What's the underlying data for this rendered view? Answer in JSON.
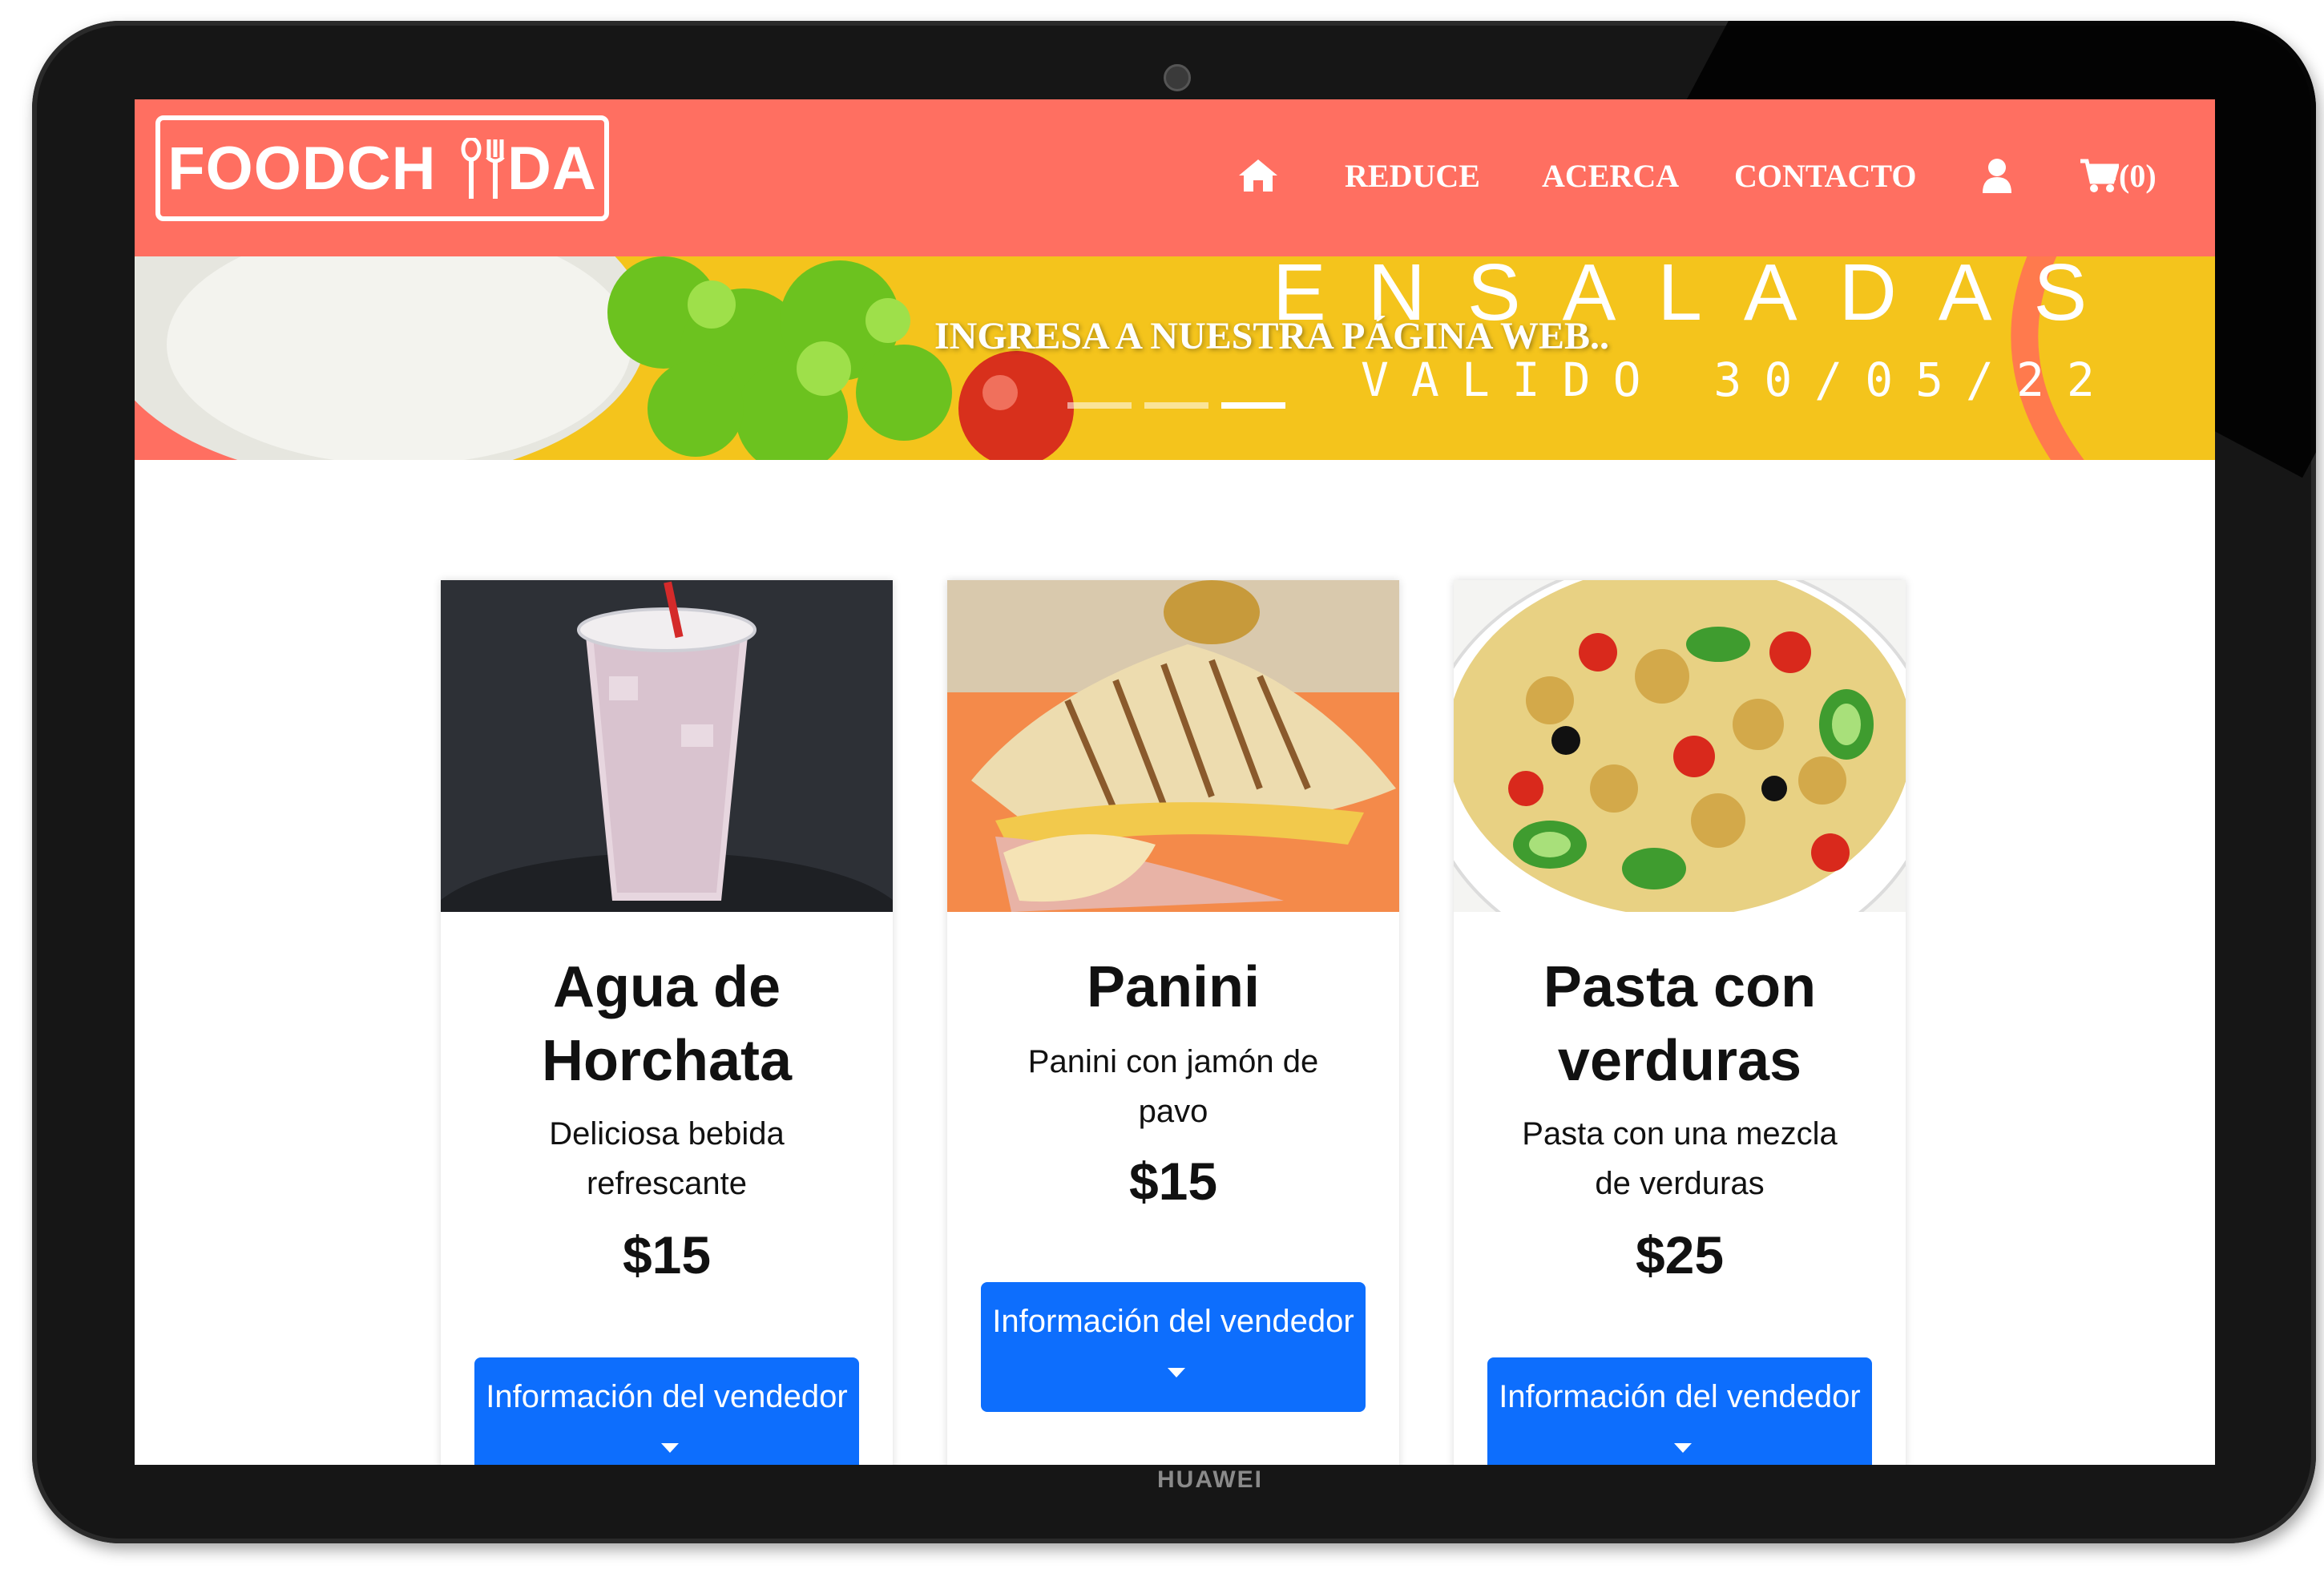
{
  "device": {
    "brand": "HUAWEI"
  },
  "navbar": {
    "logo_text": "FOODCH    DA",
    "items": [
      {
        "icon": "home-icon"
      },
      {
        "label": "REDUCE"
      },
      {
        "label": "ACERCA"
      },
      {
        "label": "CONTACTO"
      },
      {
        "icon": "user-icon"
      },
      {
        "icon": "cart-icon",
        "label": "(0)"
      }
    ]
  },
  "hero": {
    "title": "ENSALADAS",
    "subtitle": "VALIDO 30/05/22",
    "caption": "INGRESA A NUESTRA PÁGINA WEB..",
    "slides": 3,
    "active_slide": 3
  },
  "products": [
    {
      "title": "Agua de Horchata",
      "description": "Deliciosa bebida refrescante",
      "price": "$15",
      "button": "Información del vendedor"
    },
    {
      "title": "Panini",
      "description": "Panini con jamón de pavo",
      "price": "$15",
      "button": "Información del vendedor"
    },
    {
      "title": "Pasta con verduras",
      "description": "Pasta con una mezcla de verduras",
      "price": "$25",
      "button": "Información del vendedor"
    }
  ],
  "colors": {
    "navbar": "#ff6f61",
    "hero": "#f4c41c",
    "button": "#0d6efd",
    "frame": "#161616"
  }
}
